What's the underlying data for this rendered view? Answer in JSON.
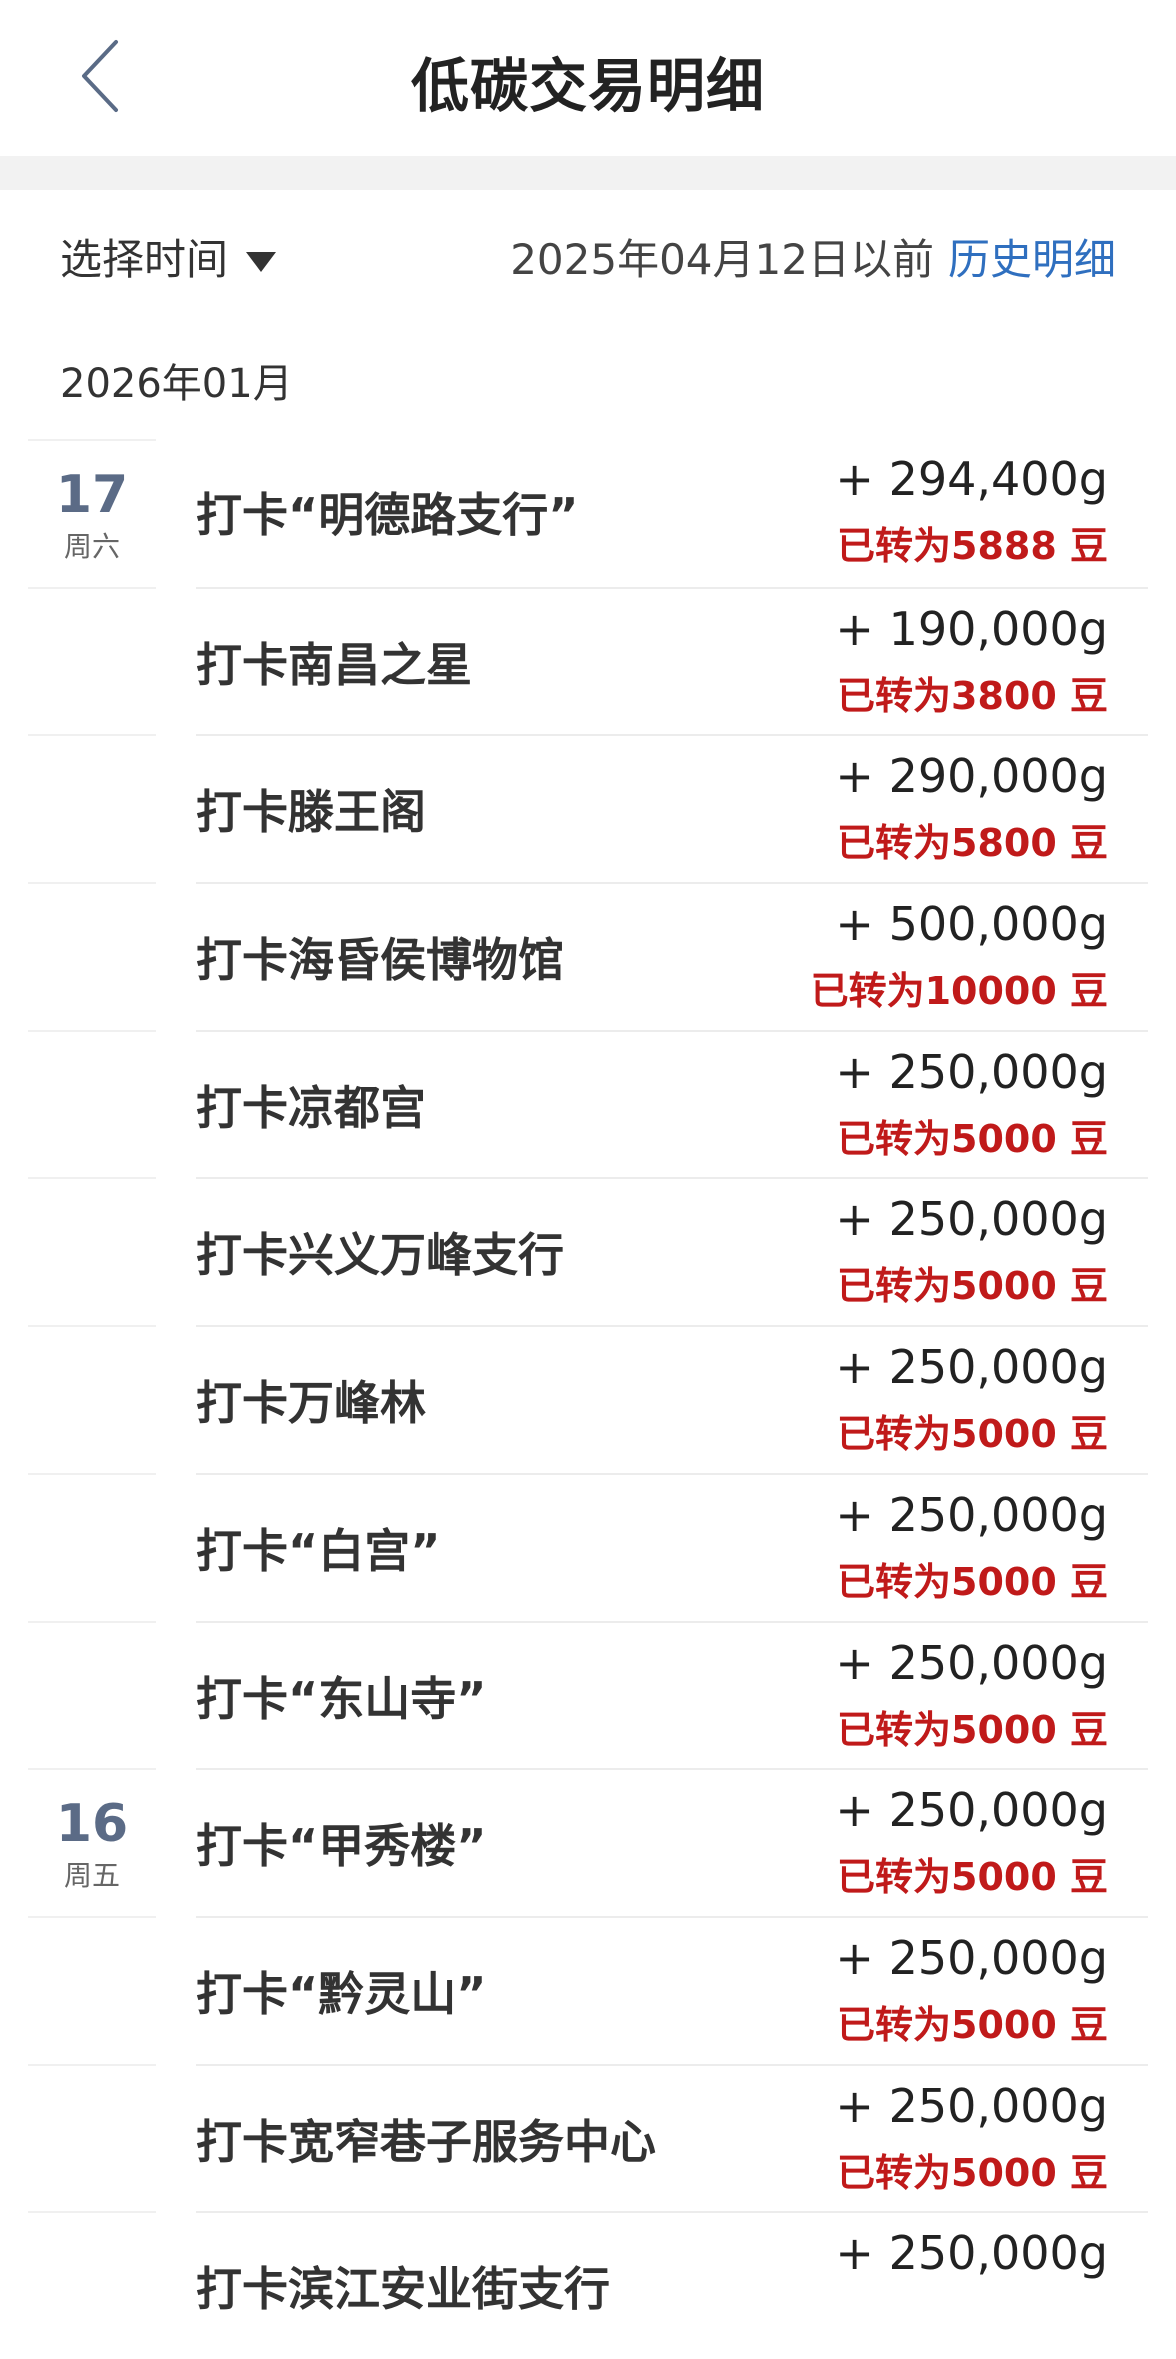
{
  "header": {
    "title": "低碳交易明细",
    "back_icon": "chevron-left-icon"
  },
  "filter": {
    "select_time_label": "选择时间",
    "before_date_text": "2025年04月12日以前",
    "history_link": "历史明细"
  },
  "month": "2026年01月",
  "days": [
    {
      "day": "17",
      "weekday": "周六"
    },
    {
      "day": "16",
      "weekday": "周五"
    }
  ],
  "items": [
    {
      "title": "打卡“明德路支行”",
      "amount": "+ 294,400g",
      "converted": "已转为5888 豆"
    },
    {
      "title": "打卡南昌之星",
      "amount": "+ 190,000g",
      "converted": "已转为3800 豆"
    },
    {
      "title": "打卡滕王阁",
      "amount": "+ 290,000g",
      "converted": "已转为5800 豆"
    },
    {
      "title": "打卡海昏侯博物馆",
      "amount": "+ 500,000g",
      "converted": "已转为10000 豆"
    },
    {
      "title": "打卡凉都宫",
      "amount": "+ 250,000g",
      "converted": "已转为5000 豆"
    },
    {
      "title": "打卡兴义万峰支行",
      "amount": "+ 250,000g",
      "converted": "已转为5000 豆"
    },
    {
      "title": "打卡万峰林",
      "amount": "+ 250,000g",
      "converted": "已转为5000 豆"
    },
    {
      "title": "打卡“白宫”",
      "amount": "+ 250,000g",
      "converted": "已转为5000 豆"
    },
    {
      "title": "打卡“东山寺”",
      "amount": "+ 250,000g",
      "converted": "已转为5000 豆"
    },
    {
      "title": "打卡“甲秀楼”",
      "amount": "+ 250,000g",
      "converted": "已转为5000 豆"
    },
    {
      "title": "打卡“黔灵山”",
      "amount": "+ 250,000g",
      "converted": "已转为5000 豆"
    },
    {
      "title": "打卡宽窄巷子服务中心",
      "amount": "+ 250,000g",
      "converted": "已转为5000 豆"
    },
    {
      "title": "打卡滨江安业街支行",
      "amount": "+ 250,000g",
      "converted": ""
    }
  ],
  "colors": {
    "accent_link": "#2f6fbf",
    "converted_red": "#c01a1a",
    "day_number": "#5b6b86"
  }
}
